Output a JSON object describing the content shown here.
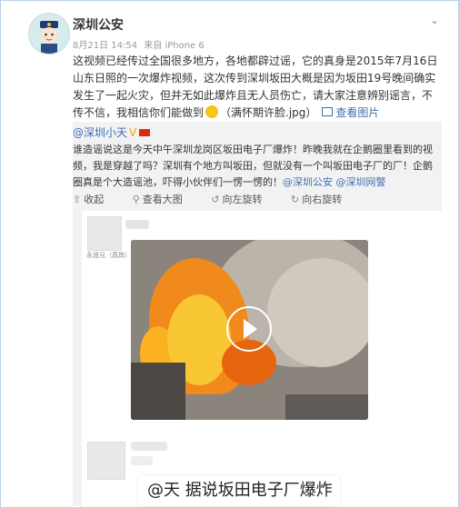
{
  "post": {
    "author": "深圳公安",
    "time": "8月21日 14:54",
    "source": "来自 iPhone 6",
    "text_before": "这视频已经传过全国很多地方，各地都辟过谣，它的真身是2015年7月16日山东日照的一次爆炸视频，这次传到深圳坂田大概是因为坂田19号晚间确实发生了一起火灾，但并无如此爆炸且无人员伤亡，请大家注意辨别谣言，不传不信，我相信你们能做到",
    "text_after": "（满怀期许脸.jpg）",
    "view_picture": "查看图片",
    "menu_icon": "chevron-down-icon"
  },
  "repost": {
    "author": "@深圳小天",
    "verified": "V",
    "text_main": "谁造谣说这是今天中午深圳龙岗区坂田电子厂爆炸！昨晚我就在企鹅圈里看到的视频，我是穿越了吗？深圳有个地方叫坂田，但就没有一个叫坂田电子厂的厂！企鹅圈真是个大造谣池，吓得小伙伴们一愣一愣的！",
    "mention1": "@深圳公安",
    "mention2": "@深圳网警",
    "tools": {
      "collapse": "收起",
      "view_large": "查看大图",
      "rotate_left": "向左旋转",
      "rotate_right": "向右旋转"
    }
  },
  "screenshot": {
    "name_tag": "永遥兄（真舆）",
    "caption": "@天 据说坂田电子厂爆炸"
  },
  "colors": {
    "link_blue": "#3f6fa8",
    "orange_link": "#eb7350",
    "repost_bg": "#f2f2f5"
  }
}
